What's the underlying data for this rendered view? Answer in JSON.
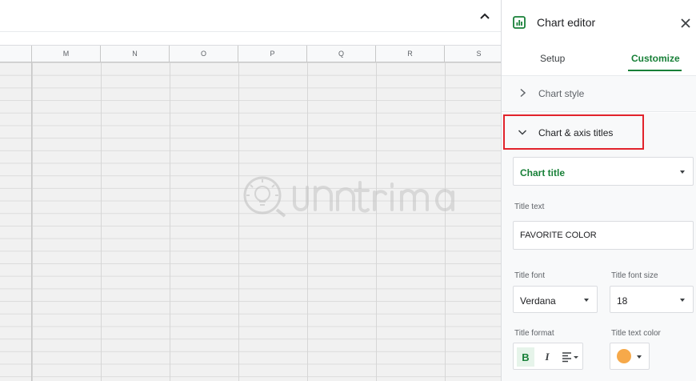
{
  "sheet": {
    "columns": [
      "M",
      "N",
      "O",
      "P",
      "Q",
      "R",
      "S"
    ]
  },
  "panel": {
    "title": "Chart editor",
    "tabs": [
      {
        "label": "Setup",
        "active": false
      },
      {
        "label": "Customize",
        "active": true
      }
    ],
    "sections": {
      "chart_style": {
        "label": "Chart style",
        "expanded": false
      },
      "chart_axis_titles": {
        "label": "Chart & axis titles",
        "expanded": true
      }
    },
    "title_type": {
      "selected": "Chart title"
    },
    "title_text": {
      "label": "Title text",
      "value": "FAVORITE COLOR"
    },
    "title_font": {
      "label": "Title font",
      "value": "Verdana"
    },
    "title_font_size": {
      "label": "Title font size",
      "value": "18"
    },
    "title_format": {
      "label": "Title format",
      "bold_glyph": "B",
      "italic_glyph": "I",
      "bold_active": true
    },
    "title_text_color": {
      "label": "Title text color",
      "color": "#f6a94a"
    }
  },
  "theme": {
    "accent": "#188038",
    "highlight_border": "#e2232b"
  }
}
